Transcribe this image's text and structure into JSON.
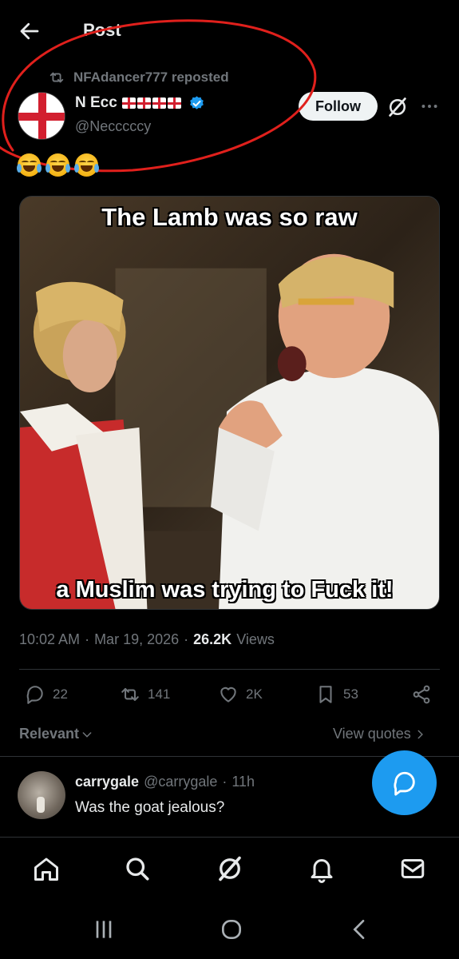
{
  "header": {
    "title": "Post"
  },
  "repost": {
    "label": "NFAdancer777 reposted"
  },
  "author": {
    "name": "N Ecc",
    "handle": "@Necccccy",
    "flag_count": 4,
    "follow_label": "Follow"
  },
  "post": {
    "emoji_count": 3,
    "emoji_icon": "face-with-tears-of-joy",
    "image": {
      "caption_top": "The Lamb was so raw",
      "caption_bottom": "a Muslim was trying to Fuck it!"
    },
    "time": "10:02 AM",
    "sep1": "·",
    "date": "Mar 19, 2026",
    "sep2": "·",
    "views_count": "26.2K",
    "views_label": "Views"
  },
  "actions": {
    "replies": "22",
    "reposts": "141",
    "likes": "2K",
    "bookmarks": "53"
  },
  "sort": {
    "label": "Relevant"
  },
  "view_quotes": {
    "label": "View quotes"
  },
  "reply": {
    "name": "carrygale",
    "handle": "@carrygale",
    "sep": "·",
    "time": "11h",
    "text": "Was the goat jealous?"
  },
  "colors": {
    "accent": "#1d9bf0",
    "background": "#000000",
    "text_primary": "#e7e9ea",
    "text_secondary": "#71767b",
    "annotation": "#e0201c",
    "flag_red": "#d21f2f"
  }
}
